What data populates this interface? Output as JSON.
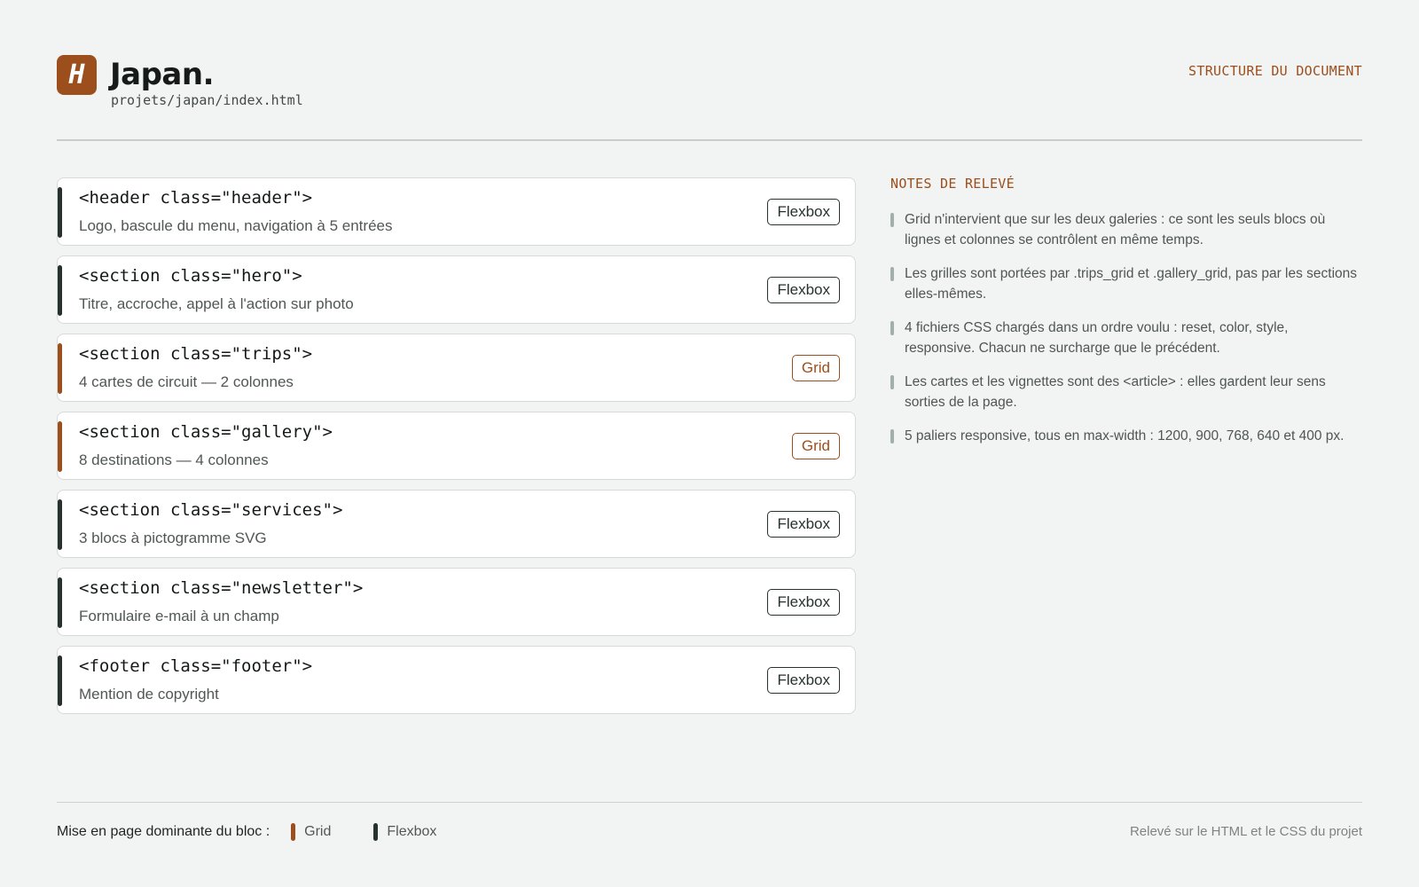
{
  "header": {
    "logo_letter": "H",
    "title": "Japan.",
    "path": "projets/japan/index.html",
    "structure_label": "STRUCTURE DU DOCUMENT"
  },
  "blocks": [
    {
      "tag": "<header class=\"header\">",
      "description": "Logo, bascule du menu, navigation à 5 entrées",
      "layout": "Flexbox",
      "kind": "flex"
    },
    {
      "tag": "<section class=\"hero\">",
      "description": "Titre, accroche, appel à l'action sur photo",
      "layout": "Flexbox",
      "kind": "flex"
    },
    {
      "tag": "<section class=\"trips\">",
      "description": "4 cartes de circuit — 2 colonnes",
      "layout": "Grid",
      "kind": "grid"
    },
    {
      "tag": "<section class=\"gallery\">",
      "description": "8 destinations — 4 colonnes",
      "layout": "Grid",
      "kind": "grid"
    },
    {
      "tag": "<section class=\"services\">",
      "description": "3 blocs à pictogramme SVG",
      "layout": "Flexbox",
      "kind": "flex"
    },
    {
      "tag": "<section class=\"newsletter\">",
      "description": "Formulaire e-mail à un champ",
      "layout": "Flexbox",
      "kind": "flex"
    },
    {
      "tag": "<footer class=\"footer\">",
      "description": "Mention de copyright",
      "layout": "Flexbox",
      "kind": "flex"
    }
  ],
  "notes": {
    "heading": "NOTES DE RELEVÉ",
    "items": [
      "Grid n'intervient que sur les deux galeries : ce sont les seuls blocs où lignes et colonnes se contrôlent en même temps.",
      "Les grilles sont portées par .trips_grid et .gallery_grid, pas par les sections elles-mêmes.",
      "4 fichiers CSS chargés dans un ordre voulu : reset, color, style, responsive. Chacun ne surcharge que le précédent.",
      "Les cartes et les vignettes sont des <article> : elles gardent leur sens sorties de la page.",
      "5 paliers responsive, tous en max-width : 1200, 900, 768, 640 et 400 px."
    ]
  },
  "footer": {
    "legend_label": "Mise en page dominante du bloc :",
    "legend_grid": "Grid",
    "legend_flex": "Flexbox",
    "credit": "Relevé sur le HTML et le CSS du projet"
  },
  "colors": {
    "accent": "#9c4e1c",
    "flex": "#27322e",
    "background": "#f2f4f3"
  }
}
